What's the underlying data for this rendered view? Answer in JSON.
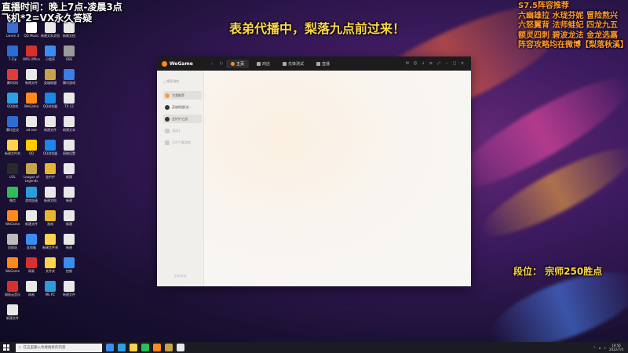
{
  "overlay": {
    "top_left_line1": "直播时间：晚上7点-凌晨3点",
    "top_left_line2": "飞机*2=VX永久答疑",
    "center_banner": "表弟代播中，梨落九点前过来！",
    "right_lines": [
      "S7.5阵容推荐",
      "六幽雄拉 水珑芬妮 冒险熬兴",
      "六怒翼背 法师蛙妃 四龙九五",
      "额灵四刺 碧波龙法 金龙选嘉",
      "阵容攻略均在微博【梨落秋溪】"
    ],
    "rank_text": "段位：  宗师250胜点"
  },
  "desktop_icons": [
    {
      "label": "Lorem 3",
      "color": "#3b6fd1"
    },
    {
      "label": "QQ Music",
      "color": "#ffffff"
    },
    {
      "label": "新建文本文档",
      "color": "#e8e8e8"
    },
    {
      "label": "新建文档",
      "color": "#e8e8e8"
    },
    {
      "label": "7-Zip",
      "color": "#2d6cd2"
    },
    {
      "label": "WPS Office",
      "color": "#d6302f"
    },
    {
      "label": "小程序",
      "color": "#3b8ef0"
    },
    {
      "label": "OBS",
      "color": "#9b9b9b"
    },
    {
      "label": "腾讯QQ",
      "color": "#e03b3b"
    },
    {
      "label": "新建文件",
      "color": "#e8e8e8"
    },
    {
      "label": "英雄联盟",
      "color": "#caa24a"
    },
    {
      "label": "腾讯游戏",
      "color": "#3a7ee8"
    },
    {
      "label": "QQ游戏",
      "color": "#2aa1e6"
    },
    {
      "label": "WeGame",
      "color": "#ff8a1c"
    },
    {
      "label": "QQ浏览器",
      "color": "#1b87e6"
    },
    {
      "label": "TX 12",
      "color": "#e8e8e8"
    },
    {
      "label": "腾讯会议",
      "color": "#2d6cd2"
    },
    {
      "label": "ad.exe",
      "color": "#e8e8e8"
    },
    {
      "label": "新建文件",
      "color": "#e8e8e8"
    },
    {
      "label": "新建文本",
      "color": "#e8e8e8"
    },
    {
      "label": "新建文件夹",
      "color": "#ffd34d"
    },
    {
      "label": "QQ",
      "color": "#ffcc00"
    },
    {
      "label": "QQ浏览器",
      "color": "#1b87e6"
    },
    {
      "label": "网络设置",
      "color": "#e8e8e8"
    },
    {
      "label": "LOL",
      "color": "#2a2a2a"
    },
    {
      "label": "League of Legends",
      "color": "#c9a34a"
    },
    {
      "label": "金铲铲",
      "color": "#e8b630"
    },
    {
      "label": "新建",
      "color": "#e8e8e8"
    },
    {
      "label": "微信",
      "color": "#2fbd5a"
    },
    {
      "label": "游戏加速",
      "color": "#2a9ed8"
    },
    {
      "label": "新建文档",
      "color": "#e8e8e8"
    },
    {
      "label": "新建",
      "color": "#e8e8e8"
    },
    {
      "label": "WeGame",
      "color": "#ff8a1c"
    },
    {
      "label": "新建文件",
      "color": "#e8e8e8"
    },
    {
      "label": "游戏",
      "color": "#e8b630"
    },
    {
      "label": "新建",
      "color": "#e8e8e8"
    },
    {
      "label": "回收站",
      "color": "#bbbbbb"
    },
    {
      "label": "此电脑",
      "color": "#3b8ef0"
    },
    {
      "label": "新建文件夹",
      "color": "#ffd34d"
    },
    {
      "label": "新建",
      "color": "#e8e8e8"
    },
    {
      "label": "WeGame",
      "color": "#ff8a1c"
    },
    {
      "label": "网易",
      "color": "#d63030"
    },
    {
      "label": "文件夹",
      "color": "#ffd34d"
    },
    {
      "label": "控制",
      "color": "#3b8ef0"
    },
    {
      "label": "网易云音乐",
      "color": "#d63030"
    },
    {
      "label": "网易",
      "color": "#e8e8e8"
    },
    {
      "label": "ME PC",
      "color": "#2a9ed8"
    },
    {
      "label": "新建文件",
      "color": "#e8e8e8"
    },
    {
      "label": "新建文件",
      "color": "#e8e8e8"
    }
  ],
  "wegame": {
    "logo": "WeGame",
    "tabs": [
      {
        "label": "主页",
        "active": true
      },
      {
        "label": "商店",
        "active": false
      },
      {
        "label": "先锋测试",
        "active": false
      },
      {
        "label": "直播",
        "active": false
      }
    ],
    "sidebar": {
      "search_placeholder": "搜索游戏",
      "items": [
        {
          "label": "为我推荐",
          "icon": "orange"
        },
        {
          "label": "英雄联盟(进...",
          "icon": "dark"
        },
        {
          "label": "金铲铲之战",
          "icon": "dark"
        },
        {
          "label": "游戏1",
          "icon": "grey"
        },
        {
          "label": "正在下载游戏",
          "icon": "grey"
        }
      ],
      "footer": "添加游戏"
    }
  },
  "taskbar": {
    "search_placeholder": "在这里输入你要搜索的内容",
    "app_colors": [
      "#3b8ef0",
      "#2aa1e6",
      "#ffd34d",
      "#2fbd5a",
      "#ff8a1c",
      "#caa24a",
      "#e8e8e8"
    ],
    "time": "19:56",
    "date": "2022/7/4"
  }
}
